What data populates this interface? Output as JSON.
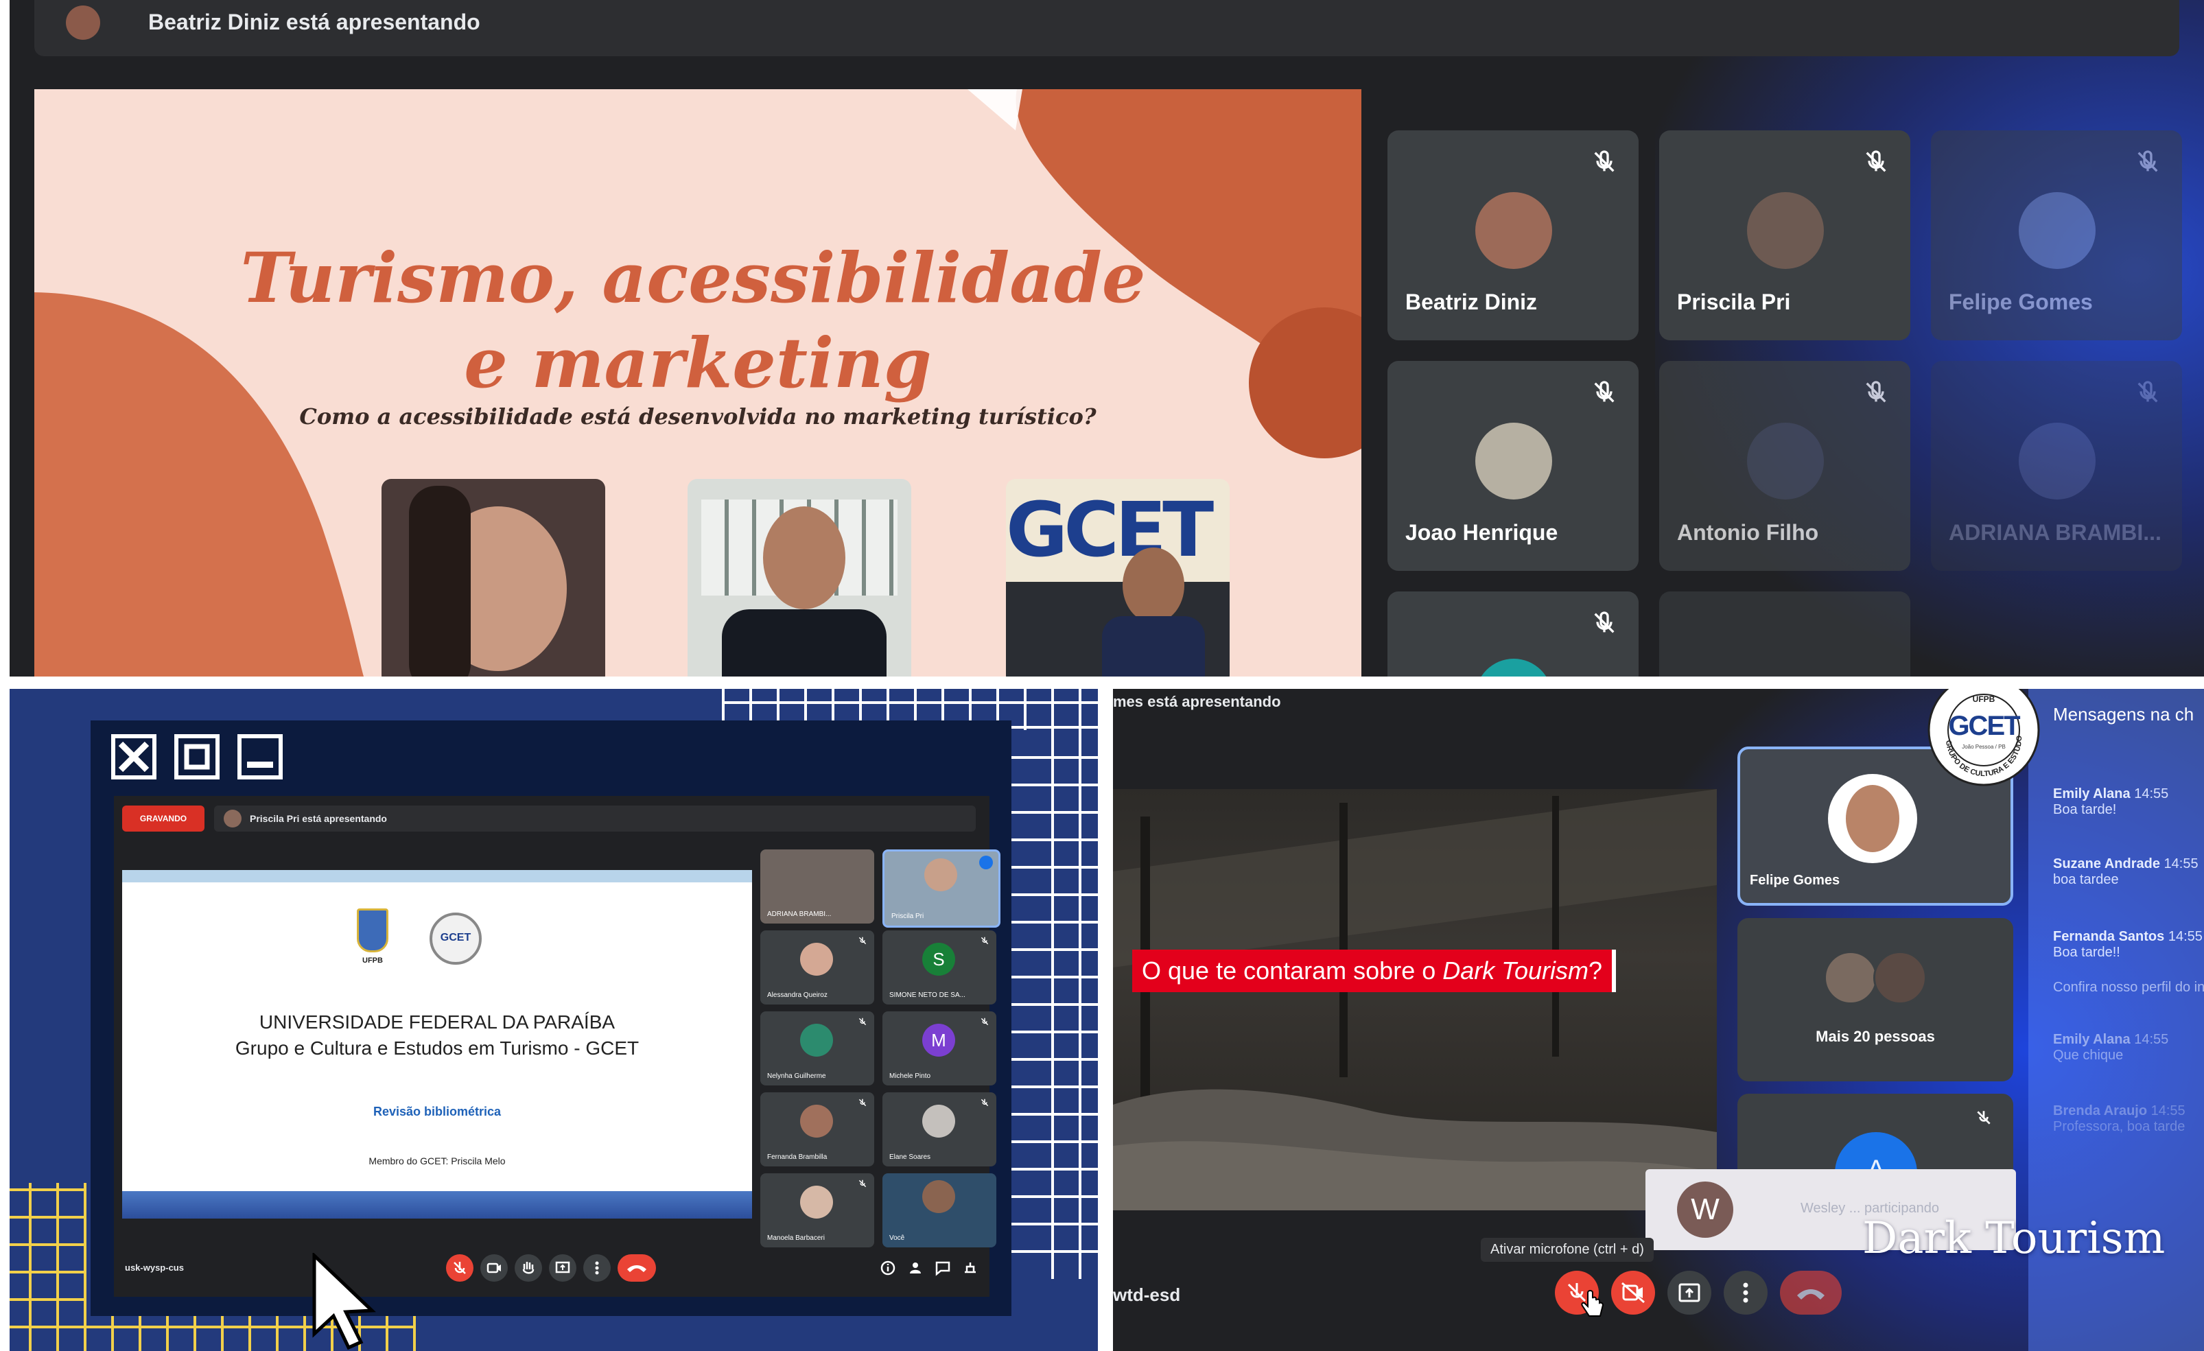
{
  "top": {
    "presenting_text": "Beatriz Diniz está apresentando",
    "slide": {
      "title_line1": "Turismo, acessibilidade",
      "title_line2": "e marketing",
      "subtitle": "Como a acessibilidade está desenvolvida no marketing turístico?",
      "logo_text": "GCET"
    },
    "participants": [
      {
        "name": "Beatriz Diniz"
      },
      {
        "name": "Priscila Pri"
      },
      {
        "name": "Felipe Gomes"
      },
      {
        "name": "Joao Henrique"
      },
      {
        "name": "Antonio Filho"
      },
      {
        "name": "ADRIANA BRAMBI..."
      }
    ]
  },
  "bottom_left": {
    "recording_label": "GRAVANDO",
    "presenting_text": "Priscila Pri está apresentando",
    "slide": {
      "logo1_label": "UFPB",
      "logo2_label": "GCET",
      "university": "UNIVERSIDADE FEDERAL DA PARAÍBA",
      "group": "Grupo e Cultura e Estudos em Turismo - GCET",
      "heading": "Revisão bibliométrica",
      "member": "Membro do GCET: Priscila Melo"
    },
    "participants": [
      {
        "name": "ADRIANA BRAMBI..."
      },
      {
        "name": "Priscila Pri"
      },
      {
        "name": "Alessandra Queiroz"
      },
      {
        "name": "SIMONE NETO DE SA...",
        "initial": "S"
      },
      {
        "name": "Nelynha Guilherme"
      },
      {
        "name": "Michele Pinto",
        "initial": "M"
      },
      {
        "name": "Fernanda Brambilla"
      },
      {
        "name": "Elane Soares"
      },
      {
        "name": "Manoela Barbaceri"
      },
      {
        "name": "Você"
      }
    ],
    "meeting_code": "usk-wysp-cus"
  },
  "bottom_right": {
    "presenting_text": "mes está apresentando",
    "caption_prefix": "O que te contaram sobre o ",
    "caption_emphasis": "Dark Tourism",
    "caption_suffix": "?",
    "tiles": [
      {
        "name": "Felipe Gomes"
      },
      {
        "name": "Mais 20 pessoas"
      }
    ],
    "partial_tile_initial": "A",
    "chat_title": "Mensagens na ch",
    "chat": [
      {
        "author": "Emily Alana",
        "time": "14:55",
        "text": "Boa tarde!"
      },
      {
        "author": "Suzane Andrade",
        "time": "14:55",
        "text": "boa tardee"
      },
      {
        "author": "Fernanda Santos",
        "time": "14:55",
        "text": "Boa tarde!!"
      },
      {
        "author": "",
        "time": "",
        "text": "Confira nosso perfil do in"
      },
      {
        "author": "Emily Alana",
        "time": "14:55",
        "text": "Que chique"
      },
      {
        "author": "Brenda Araujo",
        "time": "14:55",
        "text": "Professora, boa tarde"
      }
    ],
    "joining_initial": "W",
    "joining_text": "Wesley ... participando",
    "tooltip": "Ativar microfone (ctrl + d)",
    "meeting_code": "wtd-esd",
    "watermark": "Dark Tourism",
    "seal": {
      "top": "UFPB",
      "center": "GCET",
      "ring": "GRUPO DE CULTURA E ESTUDOS EM TURISMO",
      "small": "João Pessoa / PB"
    }
  },
  "colors": {
    "meet_bg": "#202124",
    "tile_bg": "#3c4043",
    "slide_peach": "#f9ddd3",
    "slide_orange": "#d0603e",
    "navy": "#233a7c",
    "red": "#e3001b",
    "meet_red": "#ea4335"
  }
}
